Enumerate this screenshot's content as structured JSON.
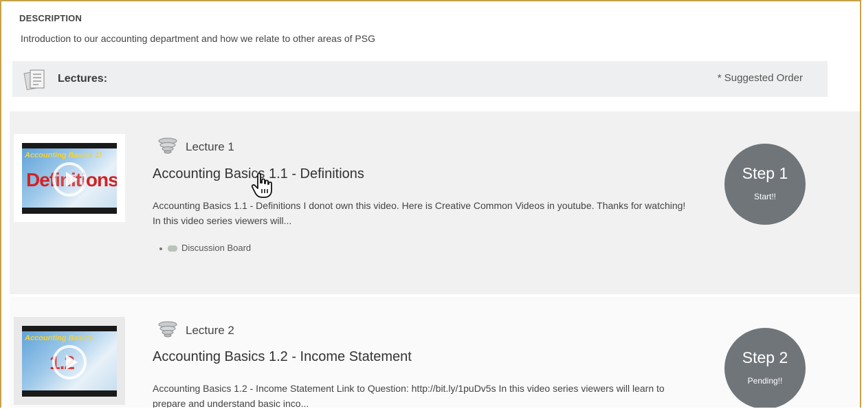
{
  "description": {
    "heading": "DESCRIPTION",
    "text": "Introduction to our accounting department and how we relate to other areas of PSG"
  },
  "lectures_header": {
    "label": "Lectures:",
    "note": "* Suggested Order",
    "icon": "document-stack-icon"
  },
  "lectures": [
    {
      "number_label": "Lecture 1",
      "title": "Accounting Basics 1.1 - Definitions",
      "description": "Accounting Basics 1.1 - Definitions I donot own this video. Here is Creative Common Videos in youtube. Thanks for watching! In this video series viewers will...",
      "link": "Discussion Board",
      "thumb_title": "Accounting Basics 1!",
      "thumb_big": "Definitions",
      "step_label": "Step 1",
      "step_status": "Start!!"
    },
    {
      "number_label": "Lecture 2",
      "title": "Accounting Basics 1.2 - Income Statement",
      "description": "Accounting Basics 1.2 - Income Statement Link to Question: http://bit.ly/1puDv5s In this video series viewers will learn to prepare and understand basic inco...",
      "thumb_title": "Accounting Basics",
      "thumb_big": "1.2",
      "step_label": "Step 2",
      "step_status": "Pending!!"
    }
  ],
  "colors": {
    "border": "#c8a24a",
    "step_circle": "#707579",
    "header_bar": "#eeeff0"
  }
}
